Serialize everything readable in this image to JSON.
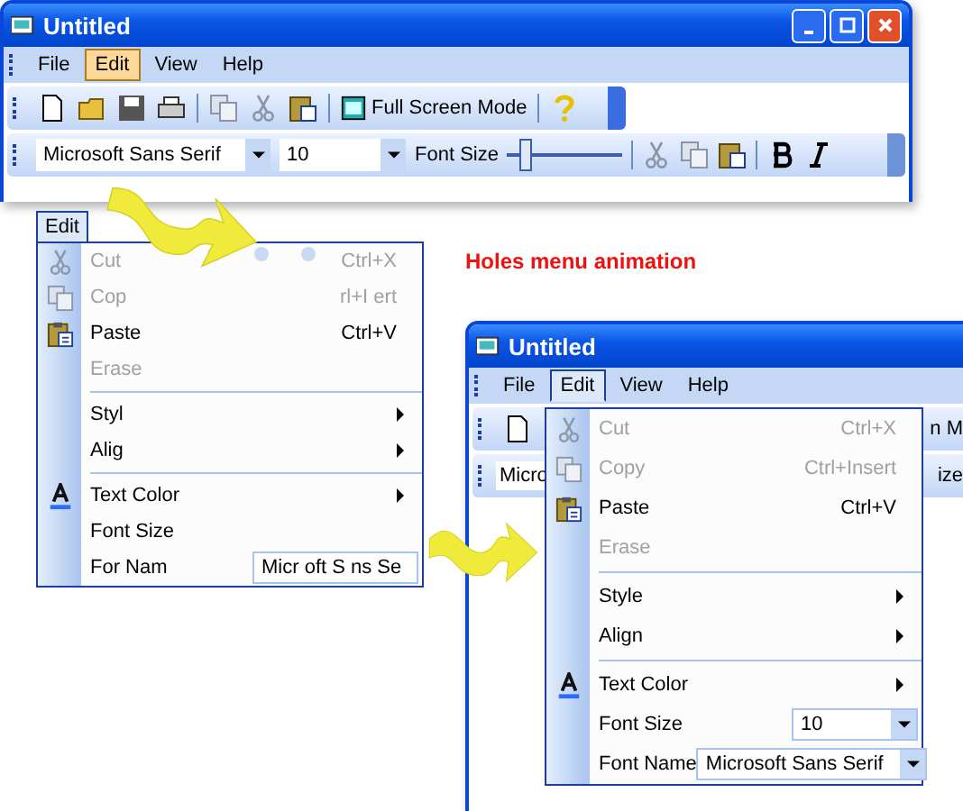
{
  "top_window": {
    "title": "Untitled",
    "menu": [
      {
        "label": "File",
        "selected": false
      },
      {
        "label": "Edit",
        "selected": true
      },
      {
        "label": "View",
        "selected": false
      },
      {
        "label": "Help",
        "selected": false
      }
    ],
    "toolbar": {
      "button_label": "Full Screen Mode"
    },
    "format_bar": {
      "font_name": "Microsoft Sans Serif",
      "font_size": "10",
      "slider_label": "Font Size",
      "slider": {
        "level": 0.1
      }
    }
  },
  "caption": "Holes menu animation",
  "holes_menu": {
    "title": "Edit",
    "items": [
      {
        "kind": "command",
        "label": "Cut",
        "shortcut": "Ctrl+X",
        "disabled": true
      },
      {
        "kind": "command",
        "label": "Cop",
        "shortcut": "rl+I ert",
        "disabled": true
      },
      {
        "kind": "command",
        "label": "Paste",
        "shortcut": "Ctrl+V",
        "disabled": false
      },
      {
        "kind": "command",
        "label": "Erase",
        "disabled": true
      },
      {
        "kind": "separator"
      },
      {
        "kind": "submenu",
        "label": "Styl"
      },
      {
        "kind": "submenu",
        "label": "Alig"
      },
      {
        "kind": "separator"
      },
      {
        "kind": "submenu",
        "label": "Text Color"
      },
      {
        "kind": "combo",
        "label": "Font Size"
      },
      {
        "kind": "combo",
        "label": "For  Nam",
        "value": "Micr oft S ns Se"
      }
    ]
  },
  "bottom_window": {
    "title": "Untitled",
    "menu": [
      {
        "label": "File",
        "selected": false
      },
      {
        "label": "Edit",
        "selected": true
      },
      {
        "label": "View",
        "selected": false
      },
      {
        "label": "Help",
        "selected": false
      }
    ],
    "toolbar_right": "n M",
    "format_left": "Micro",
    "format_right": "ize",
    "edit_menu": {
      "items": [
        {
          "kind": "command",
          "label": "Cut",
          "shortcut": "Ctrl+X",
          "disabled": true
        },
        {
          "kind": "command",
          "label": "Copy",
          "shortcut": "Ctrl+Insert",
          "disabled": true
        },
        {
          "kind": "command",
          "label": "Paste",
          "shortcut": "Ctrl+V",
          "disabled": false
        },
        {
          "kind": "command",
          "label": "Erase",
          "disabled": true
        },
        {
          "kind": "separator"
        },
        {
          "kind": "submenu",
          "label": "Style"
        },
        {
          "kind": "submenu",
          "label": "Align"
        },
        {
          "kind": "separator"
        },
        {
          "kind": "submenu",
          "label": "Text Color"
        },
        {
          "kind": "combo",
          "label": "Font Size",
          "value": "10"
        },
        {
          "kind": "combo",
          "label": "Font Name",
          "value": "Microsoft Sans Serif"
        }
      ]
    }
  }
}
